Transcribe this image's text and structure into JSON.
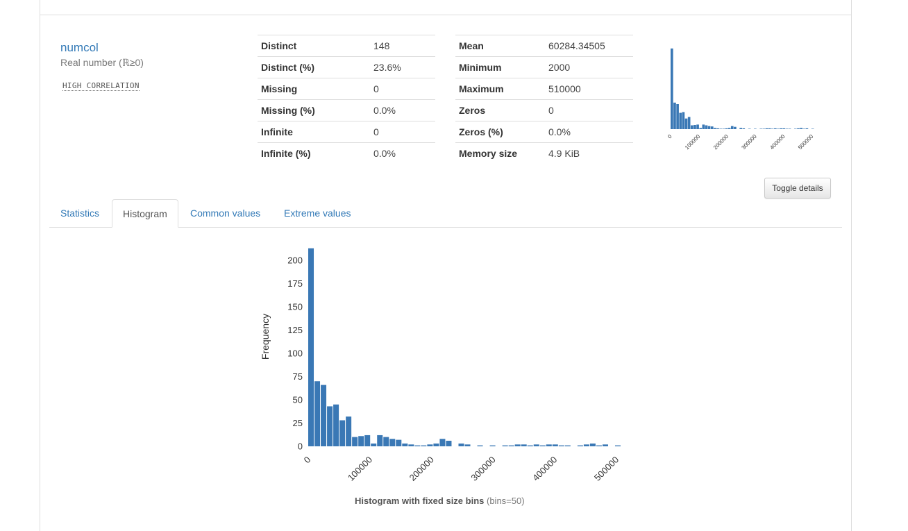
{
  "variable": {
    "name": "numcol",
    "type": "Real number (ℝ≥0)",
    "alert": "HIGH CORRELATION"
  },
  "stats_left": [
    {
      "label": "Distinct",
      "value": "148"
    },
    {
      "label": "Distinct (%)",
      "value": "23.6%"
    },
    {
      "label": "Missing",
      "value": "0"
    },
    {
      "label": "Missing (%)",
      "value": "0.0%"
    },
    {
      "label": "Infinite",
      "value": "0"
    },
    {
      "label": "Infinite (%)",
      "value": "0.0%"
    }
  ],
  "stats_right": [
    {
      "label": "Mean",
      "value": "60284.34505"
    },
    {
      "label": "Minimum",
      "value": "2000"
    },
    {
      "label": "Maximum",
      "value": "510000"
    },
    {
      "label": "Zeros",
      "value": "0"
    },
    {
      "label": "Zeros (%)",
      "value": "0.0%"
    },
    {
      "label": "Memory size",
      "value": "4.9 KiB"
    }
  ],
  "toggle_details_label": "Toggle details",
  "tabs": [
    {
      "label": "Statistics",
      "active": false
    },
    {
      "label": "Histogram",
      "active": true
    },
    {
      "label": "Common values",
      "active": false
    },
    {
      "label": "Extreme values",
      "active": false
    }
  ],
  "caption": {
    "bold": "Histogram with fixed size bins",
    "normal": "(bins=50)"
  },
  "colors": {
    "bar": "#3a78b5",
    "link": "#337ab7"
  },
  "chart_data": [
    {
      "type": "bar",
      "name": "mini-histogram",
      "x_start": 2000,
      "x_end": 510000,
      "bins": 50,
      "xticks": [
        0,
        100000,
        200000,
        300000,
        400000,
        500000
      ],
      "tick_labels": [
        "0",
        "100000",
        "200000",
        "300000",
        "400000",
        "500000"
      ],
      "ylim": [
        0,
        220
      ],
      "values": [
        213,
        70,
        66,
        43,
        45,
        28,
        32,
        10,
        11,
        12,
        3,
        12,
        10,
        8,
        7,
        3,
        2,
        1,
        1,
        2,
        3,
        8,
        6,
        0,
        3,
        2,
        0,
        1,
        0,
        1,
        0,
        1,
        1,
        2,
        2,
        1,
        2,
        1,
        2,
        2,
        1,
        1,
        0,
        1,
        2,
        3,
        1,
        2,
        0,
        1
      ]
    },
    {
      "type": "bar",
      "name": "histogram",
      "x_start": 2000,
      "x_end": 510000,
      "bins": 50,
      "xticks": [
        0,
        100000,
        200000,
        300000,
        400000,
        500000
      ],
      "tick_labels": [
        "0",
        "100000",
        "200000",
        "300000",
        "400000",
        "500000"
      ],
      "yticks": [
        0,
        25,
        50,
        75,
        100,
        125,
        150,
        175,
        200
      ],
      "ylabel": "Frequency",
      "xlabel": "",
      "ylim": [
        0,
        215
      ],
      "values": [
        213,
        70,
        66,
        43,
        45,
        28,
        32,
        10,
        11,
        12,
        3,
        12,
        10,
        8,
        7,
        3,
        2,
        1,
        1,
        2,
        3,
        8,
        6,
        0,
        3,
        2,
        0,
        1,
        0,
        1,
        0,
        1,
        1,
        2,
        2,
        1,
        2,
        1,
        2,
        2,
        1,
        1,
        0,
        1,
        2,
        3,
        1,
        2,
        0,
        1
      ]
    }
  ]
}
